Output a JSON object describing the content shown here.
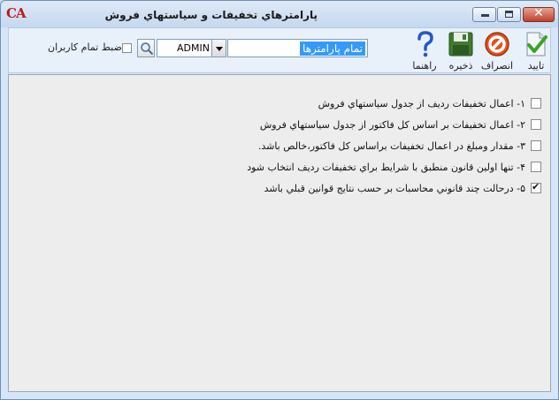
{
  "window": {
    "title": "پارامترهاي تخفيفات و سياستهاي فروش",
    "logo": "CA"
  },
  "toolbar": {
    "confirm_label": "تاييد",
    "cancel_label": "انصراف",
    "save_label": "ذخيره",
    "help_label": "راهنما",
    "param_selector_value": "تمام پارامترها",
    "user_combo_value": "ADMIN",
    "all_users_label": "ضبط تمام کاربران",
    "all_users_checked": false
  },
  "options": [
    {
      "label": "۱- اعمال تخفيفات رديف از جدول سياستهاي فروش",
      "checked": false
    },
    {
      "label": "۲- اعمال تخفيفات بر اساس کل فاکتور از جدول سياستهاي فروش",
      "checked": false
    },
    {
      "label": "۳- مقدار ومبلغ در اعمال تخفيفات براساس کل فاکتور،خالص باشد.",
      "checked": false
    },
    {
      "label": "۴- تنها اولين قانون منطبق با شرايط براي تخفيفات رديف انتخاب شود",
      "checked": false
    },
    {
      "label": "۵- درحالت چند قانوني محاسبات بر حسب نتايج قوانين قبلي باشد",
      "checked": true
    }
  ],
  "colors": {
    "cancel_icon": "#e0521b",
    "confirm_check": "#3aa524",
    "help_icon": "#2358c7",
    "save_icon": "#3f7a2f",
    "selection_highlight": "#3399ff"
  }
}
